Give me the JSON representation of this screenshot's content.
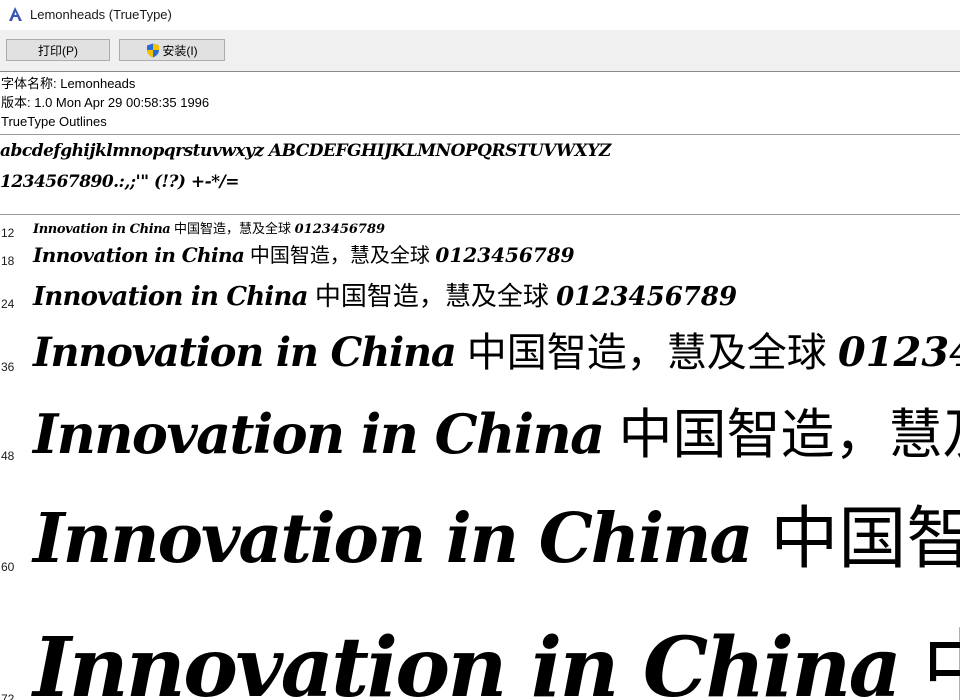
{
  "window": {
    "title": "Lemonheads (TrueType)"
  },
  "toolbar": {
    "print_label": "打印(P)",
    "install_label": "安装(I)"
  },
  "info": {
    "font_name": "字体名称: Lemonheads",
    "version": "版本: 1.0 Mon Apr 29 00:58:35 1996",
    "outline": "TrueType Outlines"
  },
  "charset": {
    "line1": "abcdefghijklmnopqrstuvwxyz ABCDEFGHIJKLMNOPQRSTUVWXYZ",
    "line2": "1234567890.:,;'\" (!?) +-*/="
  },
  "sample": {
    "latin": "Innovation in China",
    "cjk": "中国智造，慧及全球",
    "digits": "0123456789"
  },
  "sizes": [
    "12",
    "18",
    "24",
    "36",
    "48",
    "60",
    "72"
  ]
}
